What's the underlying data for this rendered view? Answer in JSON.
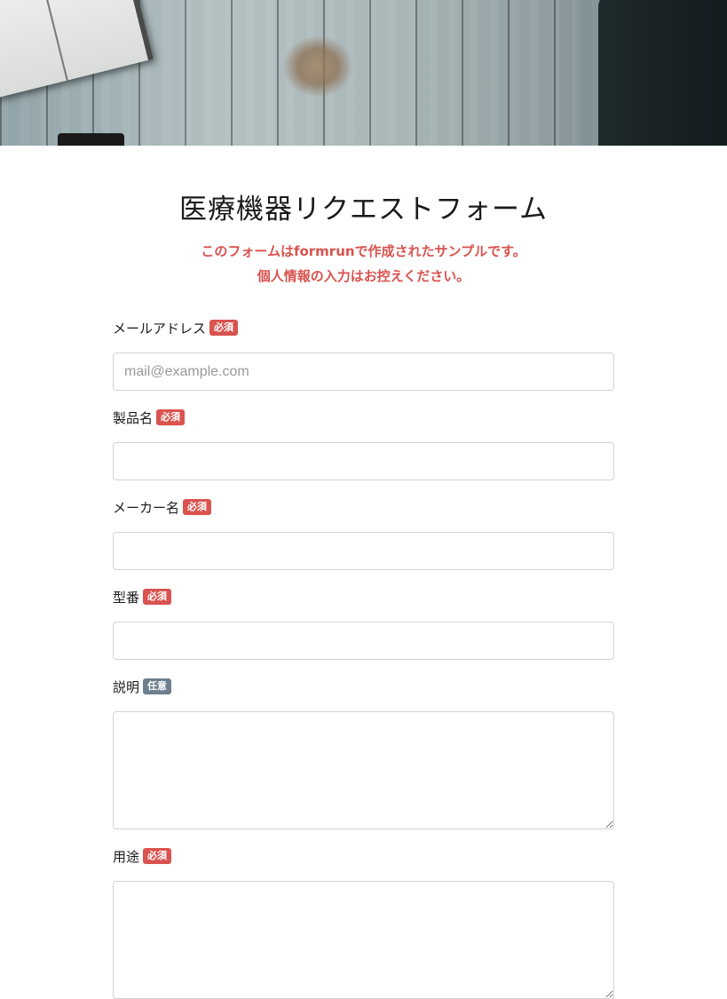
{
  "form": {
    "title": "医療機器リクエストフォーム",
    "lead_line1": "このフォームはformrunで作成されたサンプルです。",
    "lead_line2": "個人情報の入力はお控えください。"
  },
  "badges": {
    "required": "必須",
    "optional": "任意"
  },
  "fields": [
    {
      "label": "メールアドレス",
      "badge": "必須",
      "placeholder": "mail@example.com",
      "value": ""
    },
    {
      "label": "製品名",
      "badge": "必須",
      "placeholder": "",
      "value": ""
    },
    {
      "label": "メーカー名",
      "badge": "必須",
      "placeholder": "",
      "value": ""
    },
    {
      "label": "型番",
      "badge": "必須",
      "placeholder": "",
      "value": ""
    },
    {
      "label": "説明",
      "badge": "任意",
      "placeholder": "",
      "value": ""
    },
    {
      "label": "用途",
      "badge": "必須",
      "placeholder": "",
      "value": ""
    }
  ],
  "colors": {
    "accent": "#d9534f",
    "required_badge": "#d9534f",
    "optional_badge": "#6c7f8f",
    "input_border": "#cfd4d8"
  }
}
